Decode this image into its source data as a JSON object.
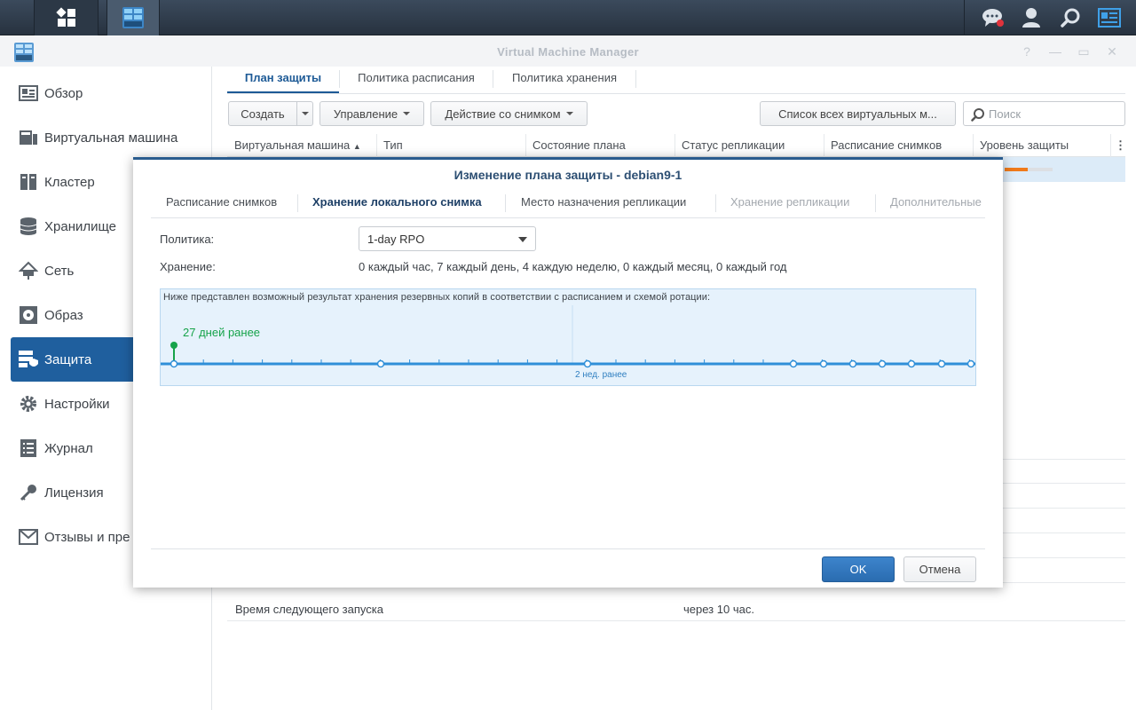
{
  "app": {
    "window_title": "Virtual Machine Manager"
  },
  "sidebar": {
    "items": [
      {
        "label": "Обзор",
        "icon": "overview-icon"
      },
      {
        "label": "Виртуальная машина",
        "icon": "virtual-machine-icon"
      },
      {
        "label": "Кластер",
        "icon": "cluster-icon"
      },
      {
        "label": "Хранилище",
        "icon": "storage-icon"
      },
      {
        "label": "Сеть",
        "icon": "network-icon"
      },
      {
        "label": "Образ",
        "icon": "image-disc-icon"
      },
      {
        "label": "Защита",
        "icon": "protection-icon"
      },
      {
        "label": "Настройки",
        "icon": "gear-icon"
      },
      {
        "label": "Журнал",
        "icon": "log-icon"
      },
      {
        "label": "Лицензия",
        "icon": "key-icon"
      },
      {
        "label": "Отзывы и пре",
        "icon": "mail-icon"
      }
    ],
    "active_index": 6
  },
  "main": {
    "tabs": [
      "План защиты",
      "Политика расписания",
      "Политика хранения"
    ],
    "toolbar": {
      "create": "Создать",
      "manage": "Управление",
      "snapshot_action": "Действие со снимком",
      "all_vms": "Список всех виртуальных м...",
      "search_placeholder": "Поиск"
    },
    "columns": [
      "Виртуальная машина",
      "Тип",
      "Состояние плана",
      "Статус репликации",
      "Расписание снимков",
      "Уровень защиты"
    ],
    "details": {
      "next_run_label": "Время следующего запуска",
      "next_run_value": "через 10 час."
    }
  },
  "modal": {
    "title": "Изменение плана защиты - debian9-1",
    "tabs": [
      "Расписание снимков",
      "Хранение локального снимка",
      "Место назначения репликации",
      "Хранение репликации",
      "Дополнительные"
    ],
    "policy_label": "Политика:",
    "policy_value": "1-day RPO",
    "retention_label": "Хранение:",
    "retention_value": "0 каждый час, 7 каждый день, 4 каждую неделю, 0 каждый месяц, 0 каждый год",
    "timeline_note": "Ниже представлен возможный результат хранения резервных копий в соответствии с расписанием и схемой ротации:",
    "timeline_marker_label": "27 дней ранее",
    "timeline_mid_label": "2 нед. ранее",
    "ok": "OK",
    "cancel": "Отмена"
  },
  "colors": {
    "accent": "#1f5f9e",
    "timeline_line": "#2f8fd8",
    "marker_green": "#16a34a"
  }
}
